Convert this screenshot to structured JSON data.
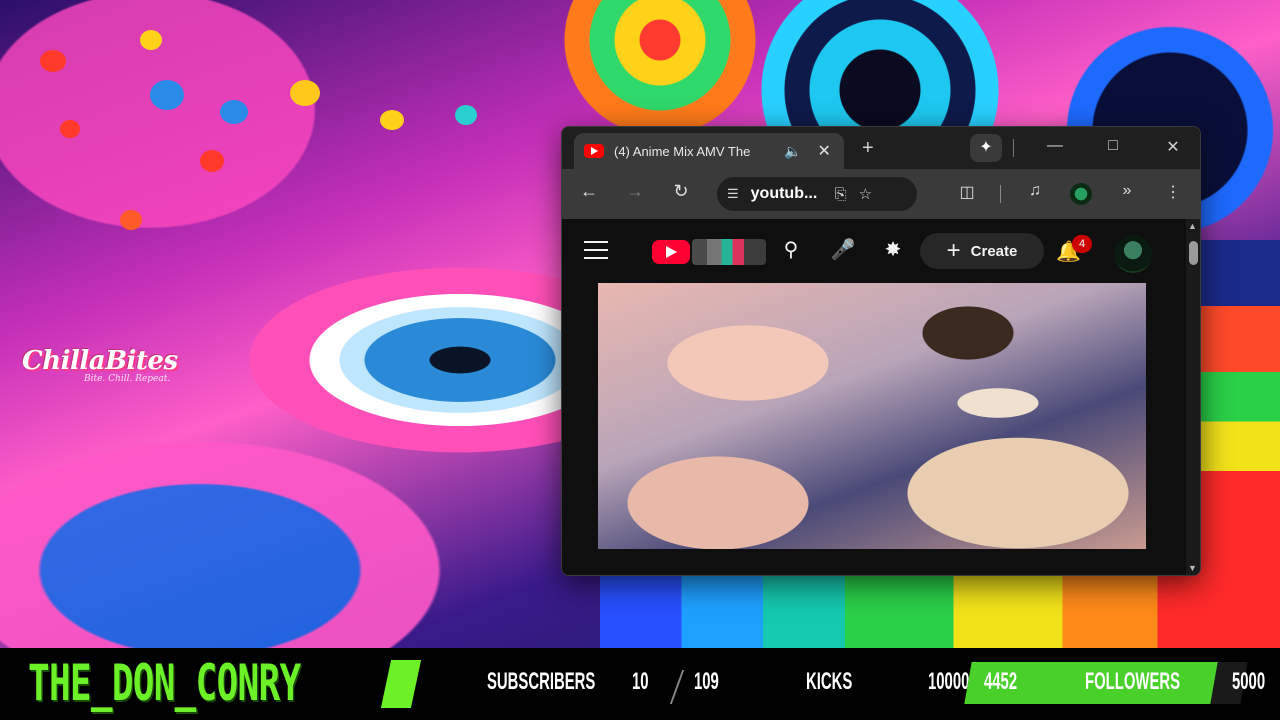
{
  "logo": {
    "name": "ChillaBites",
    "tagline": "Bite. Chill. Repeat."
  },
  "browser": {
    "tab": {
      "title": "(4) Anime Mix AMV The",
      "audio_icon": "speaker-icon",
      "close_icon": "close-icon"
    },
    "new_tab_icon": "plus-icon",
    "window_controls": [
      "minimize-icon",
      "maximize-icon",
      "close-icon"
    ],
    "address_bar": {
      "url": "youtub..."
    },
    "youtube": {
      "create_label": "Create",
      "notifications_count": "4"
    }
  },
  "stream_overlay": {
    "channel_name": "THE_DON_CONRY",
    "subscribers": {
      "label": "SUBSCRIBERS",
      "current": "10",
      "goal": "109"
    },
    "kicks": {
      "label": "KICKS",
      "goal": "10000"
    },
    "followers": {
      "label": "FOLLOWERS",
      "current": "4452",
      "goal": "5000",
      "progress": 0.89
    },
    "colors": {
      "accent_green": "#6cf028",
      "bar_green": "#4ad02a"
    }
  }
}
